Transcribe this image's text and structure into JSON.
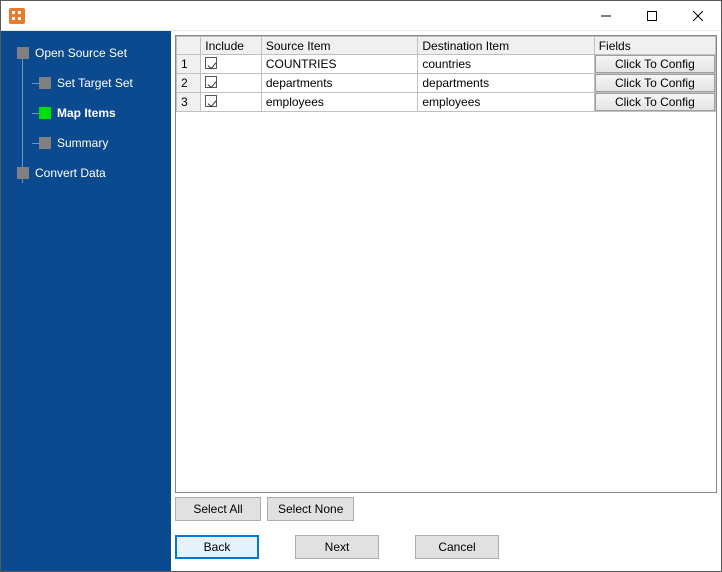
{
  "title": "",
  "sidebar": {
    "items": [
      {
        "label": "Open Source Set",
        "type": "root",
        "active": false
      },
      {
        "label": "Set Target Set",
        "type": "child",
        "active": false
      },
      {
        "label": "Map Items",
        "type": "child",
        "active": true
      },
      {
        "label": "Summary",
        "type": "child",
        "active": false
      },
      {
        "label": "Convert Data",
        "type": "root",
        "active": false
      }
    ]
  },
  "grid": {
    "headers": {
      "rownum": "",
      "include": "Include",
      "source": "Source Item",
      "dest": "Destination Item",
      "fields": "Fields"
    },
    "config_label": "Click To Config",
    "rows": [
      {
        "n": "1",
        "include": true,
        "source": "COUNTRIES",
        "dest": "countries"
      },
      {
        "n": "2",
        "include": true,
        "source": "departments",
        "dest": "departments"
      },
      {
        "n": "3",
        "include": true,
        "source": "employees",
        "dest": "employees"
      }
    ]
  },
  "buttons": {
    "select_all": "Select All",
    "select_none": "Select None",
    "back": "Back",
    "next": "Next",
    "cancel": "Cancel"
  }
}
